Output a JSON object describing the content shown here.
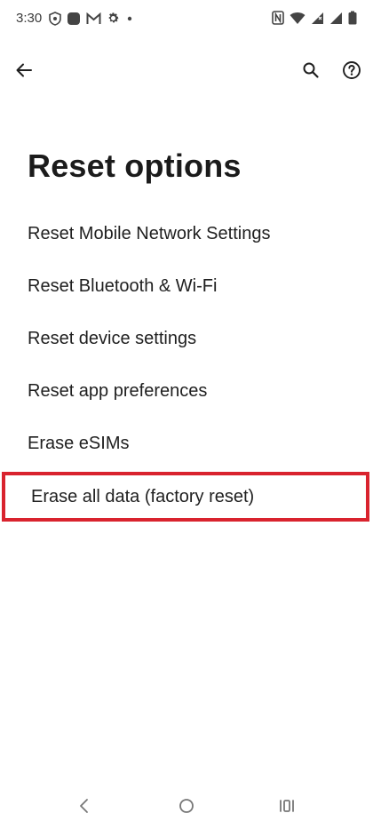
{
  "status_bar": {
    "time": "3:30",
    "left_icons": [
      "shield-icon",
      "app-icon",
      "gmail-icon",
      "settings-gear-icon",
      "dot-icon"
    ],
    "right_icons": [
      "nfc-icon",
      "wifi-icon",
      "signal-icon",
      "signal-icon-2",
      "battery-icon"
    ]
  },
  "app_bar": {
    "back_icon": "arrow-back-icon",
    "search_icon": "search-icon",
    "help_icon": "help-icon"
  },
  "page": {
    "title": "Reset options"
  },
  "options": [
    {
      "label": "Reset Mobile Network Settings"
    },
    {
      "label": "Reset Bluetooth & Wi-Fi"
    },
    {
      "label": "Reset device settings"
    },
    {
      "label": "Reset app preferences"
    },
    {
      "label": "Erase eSIMs"
    },
    {
      "label": "Erase all data (factory reset)"
    }
  ],
  "highlight_color": "#d9232e",
  "nav_bar": {
    "back_icon": "nav-back-icon",
    "home_icon": "nav-home-icon",
    "recents_icon": "nav-recents-icon"
  }
}
